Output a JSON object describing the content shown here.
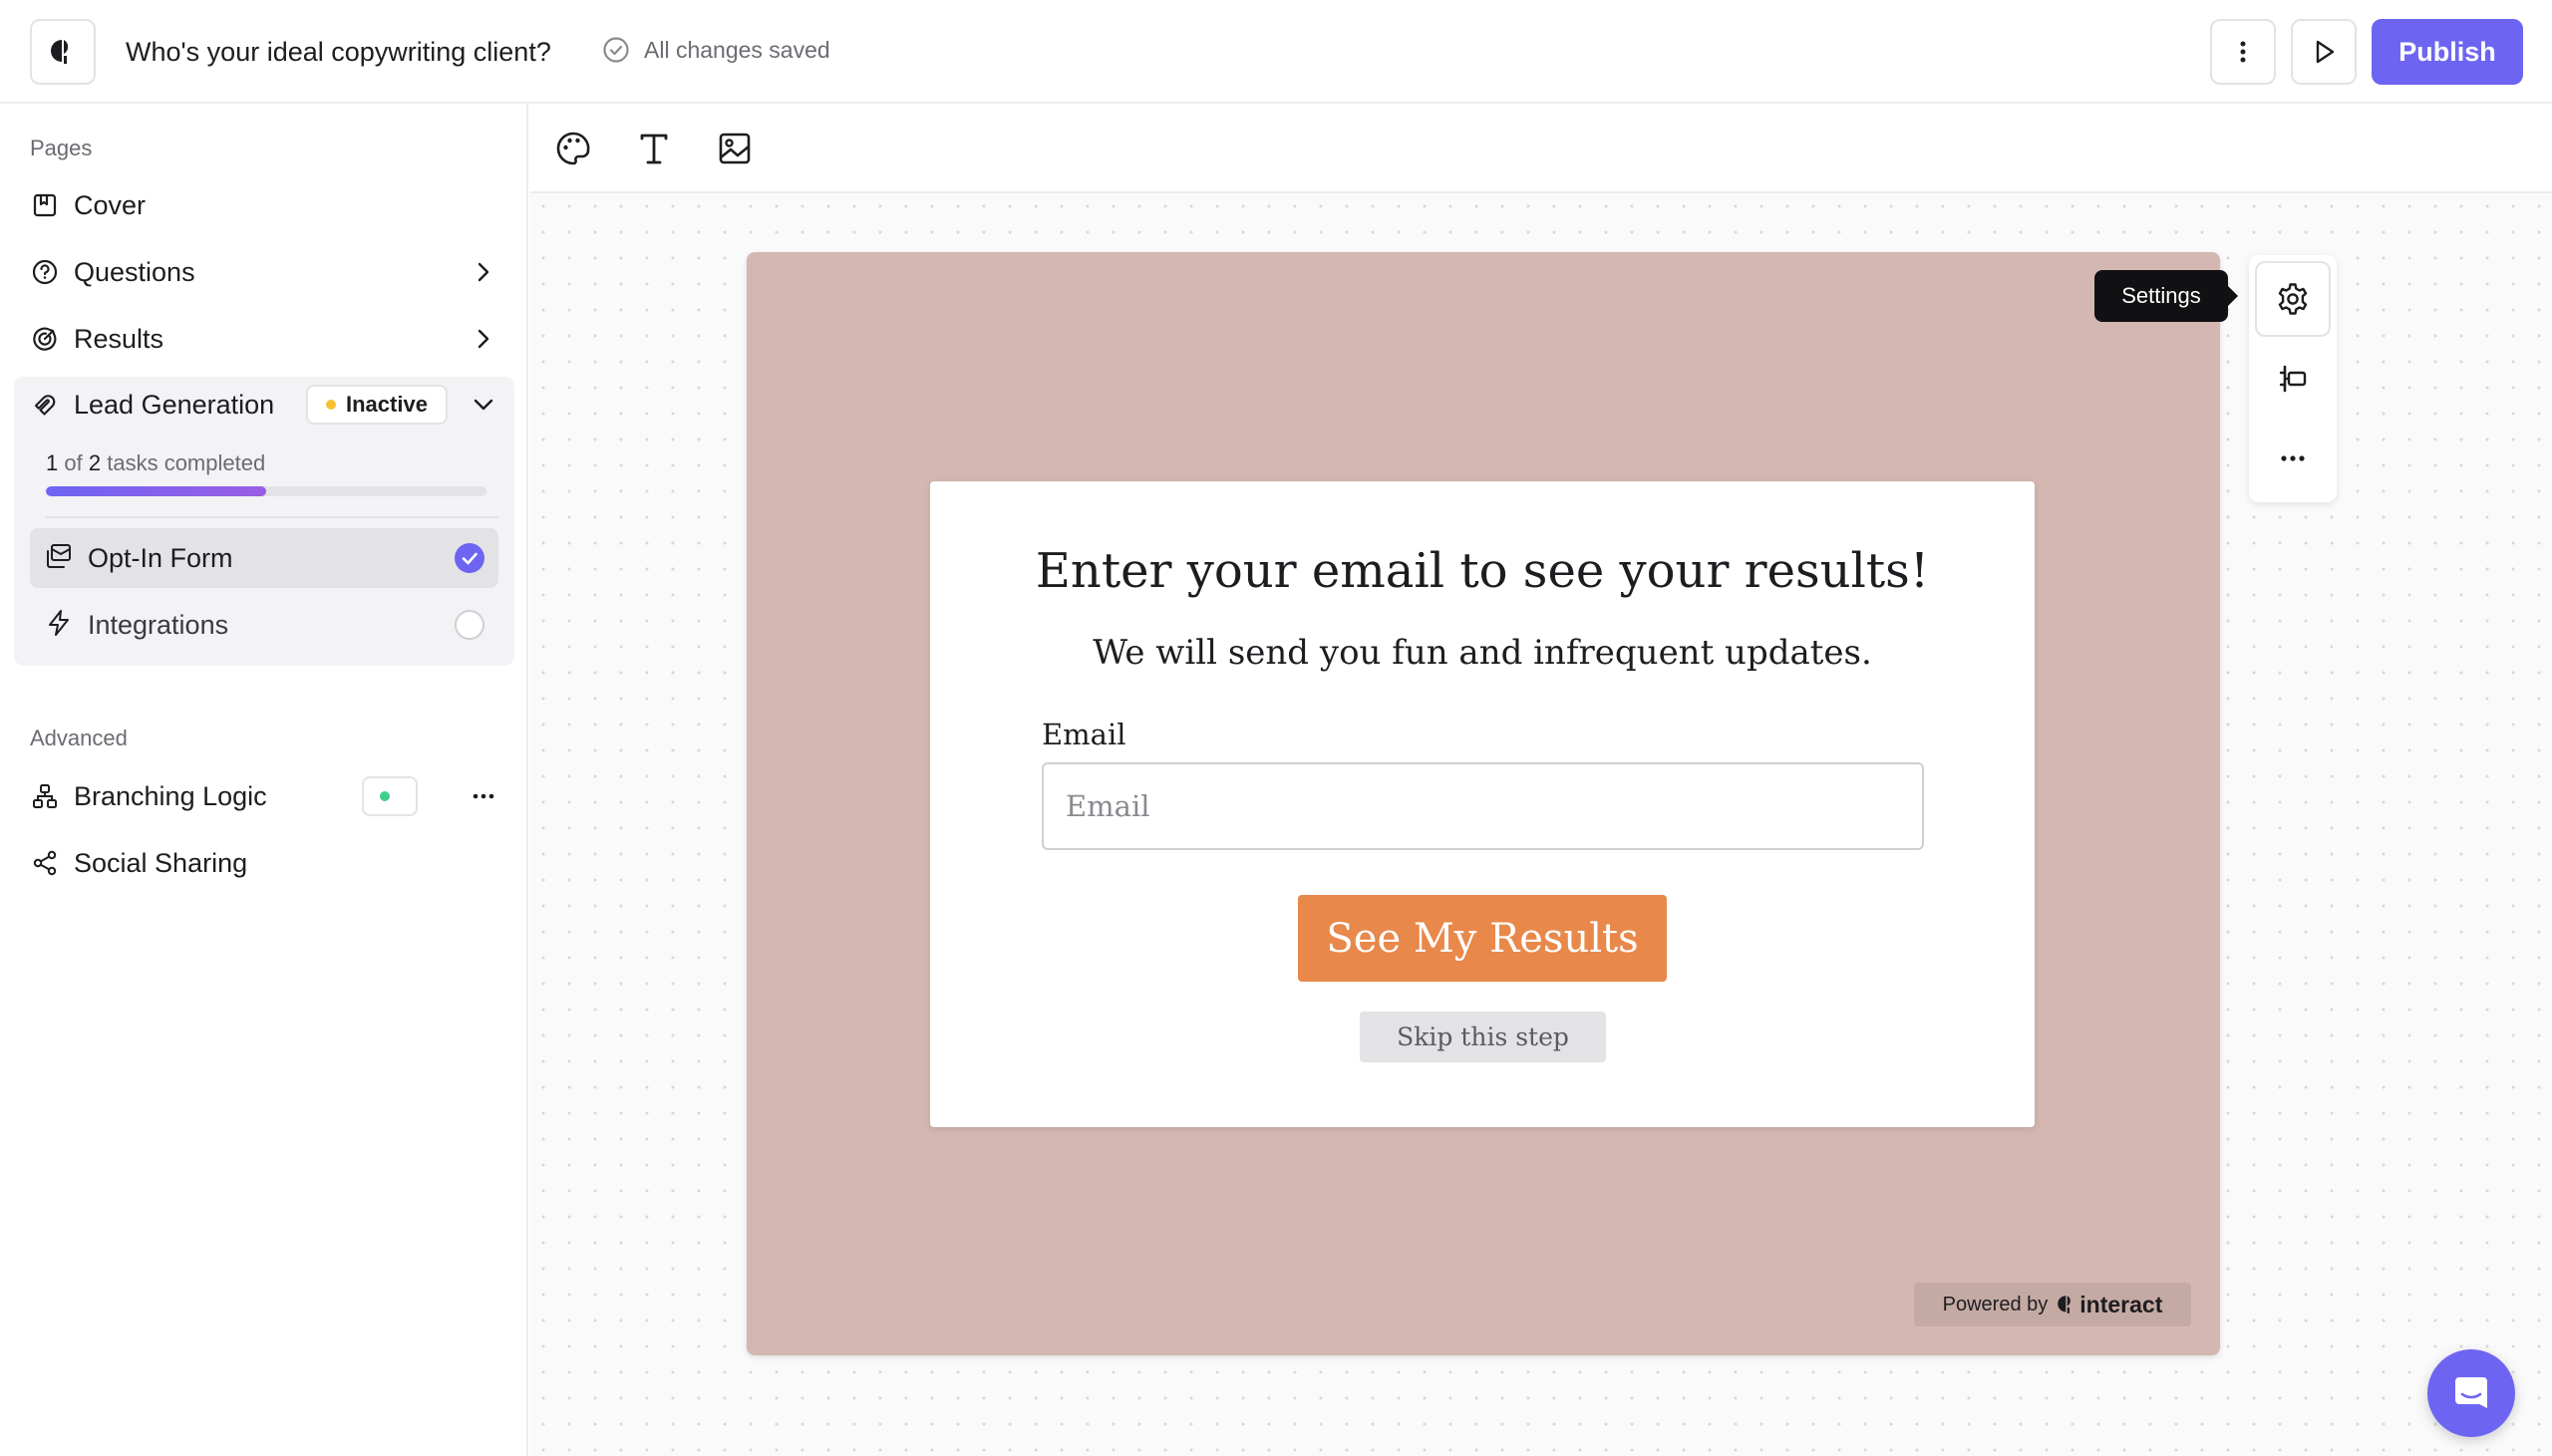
{
  "header": {
    "quiz_title": "Who's your ideal copywriting client?",
    "save_status": "All changes saved",
    "publish_label": "Publish"
  },
  "sidebar": {
    "pages_label": "Pages",
    "pages": [
      {
        "label": "Cover",
        "icon": "bookmark-icon"
      },
      {
        "label": "Questions",
        "icon": "question-circle-icon"
      },
      {
        "label": "Results",
        "icon": "target-icon"
      }
    ],
    "lead_generation": {
      "label": "Lead Generation",
      "status": "Inactive",
      "status_color": "#f5c132",
      "tasks_done": "1",
      "tasks_total": "2",
      "tasks_of": "of",
      "tasks_suffix": "tasks completed",
      "progress": 0.5,
      "tasks": [
        {
          "label": "Opt-In Form",
          "done": true
        },
        {
          "label": "Integrations",
          "done": false
        }
      ]
    },
    "advanced_label": "Advanced",
    "advanced": [
      {
        "label": "Branching Logic",
        "status": "On",
        "status_color": "#3ecf8e"
      },
      {
        "label": "Social Sharing"
      }
    ]
  },
  "toolbar": {
    "tools": [
      "palette-icon",
      "text-icon",
      "image-icon"
    ]
  },
  "form": {
    "title": "Enter your email to see your results!",
    "subtitle": "We will send you fun and infrequent updates.",
    "email_label": "Email",
    "email_placeholder": "Email",
    "submit_label": "See My Results",
    "skip_label": "Skip this step",
    "button_color": "#e8884a",
    "page_bg": "#d3b7b0"
  },
  "branding": {
    "powered_by": "Powered by",
    "brand": "interact"
  },
  "side_tools": {
    "tooltip": "Settings"
  },
  "colors": {
    "accent": "#6d65f2"
  }
}
